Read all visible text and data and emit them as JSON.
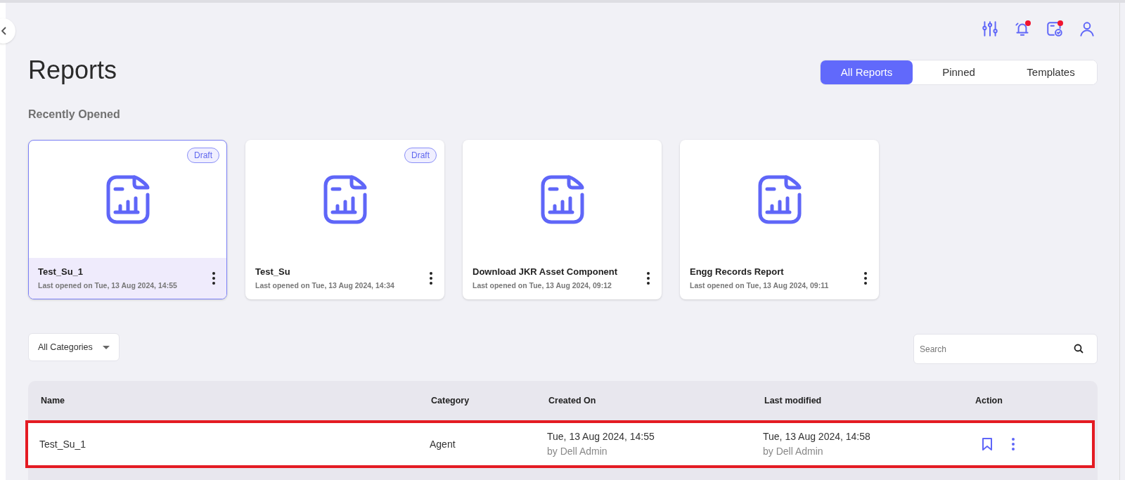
{
  "page": {
    "title": "Reports"
  },
  "header_icons": [
    {
      "kind": "sliders",
      "badge": false
    },
    {
      "kind": "bell",
      "badge": true
    },
    {
      "kind": "calendar",
      "badge": true
    },
    {
      "kind": "user",
      "badge": false
    }
  ],
  "tabs": [
    {
      "label": "All Reports",
      "selected": true
    },
    {
      "label": "Pinned",
      "selected": false
    },
    {
      "label": "Templates",
      "selected": false
    }
  ],
  "recent": {
    "heading": "Recently Opened",
    "cards": [
      {
        "name": "Test_Su_1",
        "opened": "Last opened on Tue, 13 Aug 2024, 14:55",
        "badge": "Draft",
        "selected": true
      },
      {
        "name": "Test_Su",
        "opened": "Last opened on Tue, 13 Aug 2024, 14:34",
        "badge": "Draft",
        "selected": false
      },
      {
        "name": "Download JKR Asset Component",
        "opened": "Last opened on Tue, 13 Aug 2024, 09:12",
        "selected": false
      },
      {
        "name": "Engg Records Report",
        "opened": "Last opened on Tue, 13 Aug 2024, 09:11",
        "selected": false
      }
    ]
  },
  "filter": {
    "value": "All Categories"
  },
  "search": {
    "placeholder": "Search"
  },
  "table": {
    "columns": [
      "Name",
      "Category",
      "Created On",
      "Last modified",
      "Action"
    ],
    "rows": [
      {
        "name": "Test_Su_1",
        "category": "Agent",
        "created": "Tue, 13 Aug 2024, 14:55",
        "created_by": "by Dell Admin",
        "modified": "Tue, 13 Aug 2024, 14:58",
        "modified_by": "by Dell Admin",
        "highlighted": true
      }
    ]
  }
}
